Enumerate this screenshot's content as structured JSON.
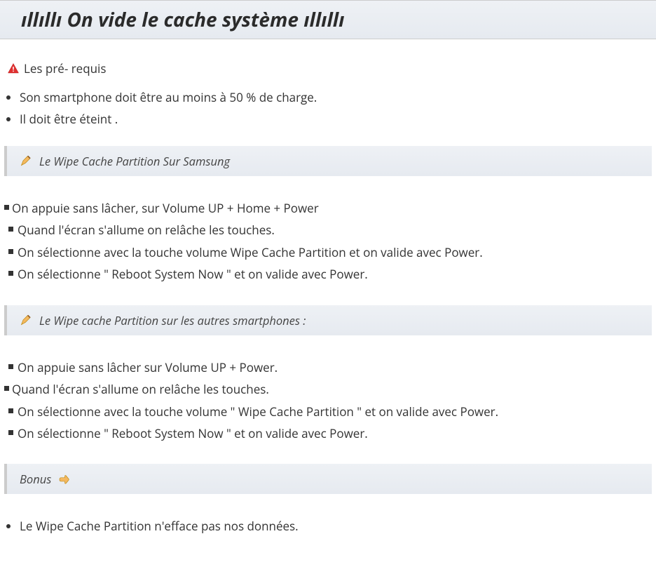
{
  "title": "ıllıllı On vide le cache système ıllıllı",
  "prereq_header": "Les pré- requis",
  "prereq_items": [
    "Son smartphone doit être au moins à 50 % de charge.",
    "Il doit être éteint ."
  ],
  "section_samsung": {
    "title": "Le Wipe Cache Partition Sur Samsung",
    "items": [
      "On appuie sans lâcher, sur Volume UP + Home + Power",
      "Quand l'écran s'allume on relâche les touches.",
      "On sélectionne avec la touche volume Wipe Cache Partition et on valide avec Power.",
      "On sélectionne \" Reboot System Now \" et on valide avec Power."
    ]
  },
  "section_other": {
    "title": "Le Wipe cache Partition sur les autres smartphones :",
    "items": [
      "On appuie sans lâcher sur Volume UP + Power.",
      "Quand l'écran s'allume on relâche les touches.",
      "On sélectionne avec la touche volume \" Wipe Cache Partition \" et on valide avec Power.",
      "On sélectionne \" Reboot System Now \" et on valide avec Power."
    ]
  },
  "section_bonus": {
    "title": "Bonus",
    "items": [
      "Le Wipe Cache Partition n'efface pas nos données."
    ]
  }
}
